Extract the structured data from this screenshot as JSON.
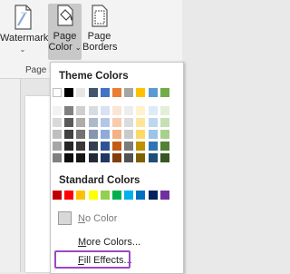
{
  "ribbon": {
    "watermark": {
      "label": "Watermark",
      "chevron": "⌄"
    },
    "page_color": {
      "line1": "Page",
      "line2": "Color",
      "chevron": "⌄"
    },
    "page_borders": {
      "line1": "Page",
      "line2": "Borders"
    },
    "group_label": "Page B"
  },
  "menu": {
    "theme_heading": "Theme Colors",
    "standard_heading": "Standard Colors",
    "no_color": {
      "underlined": "N",
      "rest": "o Color"
    },
    "more_colors": {
      "underlined": "M",
      "rest": "ore Colors..."
    },
    "fill_effects": {
      "underlined": "F",
      "rest": "ill Effects..."
    }
  },
  "theme_colors": {
    "top_row": [
      "#ffffff",
      "#000000",
      "#e7e6e6",
      "#44546a",
      "#4472c4",
      "#ed7d31",
      "#a5a5a5",
      "#ffc000",
      "#5b9bd5",
      "#70ad47"
    ],
    "shade_columns": [
      [
        "#f2f2f2",
        "#d9d9d9",
        "#bfbfbf",
        "#a6a6a6",
        "#808080"
      ],
      [
        "#808080",
        "#595959",
        "#404040",
        "#262626",
        "#0d0d0d"
      ],
      [
        "#d0cece",
        "#aeabab",
        "#757171",
        "#3a3838",
        "#171616"
      ],
      [
        "#d6dce4",
        "#adb9ca",
        "#8496b0",
        "#333f4f",
        "#222a35"
      ],
      [
        "#d9e2f3",
        "#b4c6e7",
        "#8eaadb",
        "#2f5496",
        "#1f3864"
      ],
      [
        "#fbe5d5",
        "#f7cbac",
        "#f4b183",
        "#c55a11",
        "#833c0b"
      ],
      [
        "#ededed",
        "#dbdbdb",
        "#c9c9c9",
        "#7b7b7b",
        "#525252"
      ],
      [
        "#fff2cc",
        "#fee599",
        "#ffd965",
        "#bf9000",
        "#7f6000"
      ],
      [
        "#deebf6",
        "#bdd7ee",
        "#9dc3e6",
        "#2e75b5",
        "#1e4e79"
      ],
      [
        "#e2efd9",
        "#c5e0b3",
        "#a8d08d",
        "#538135",
        "#375623"
      ]
    ]
  },
  "standard_colors": [
    "#c00000",
    "#ff0000",
    "#ffc000",
    "#ffff00",
    "#92d050",
    "#00b050",
    "#00b0f0",
    "#0070c0",
    "#002060",
    "#7030a0"
  ],
  "accent_highlight": "#9b48c5"
}
